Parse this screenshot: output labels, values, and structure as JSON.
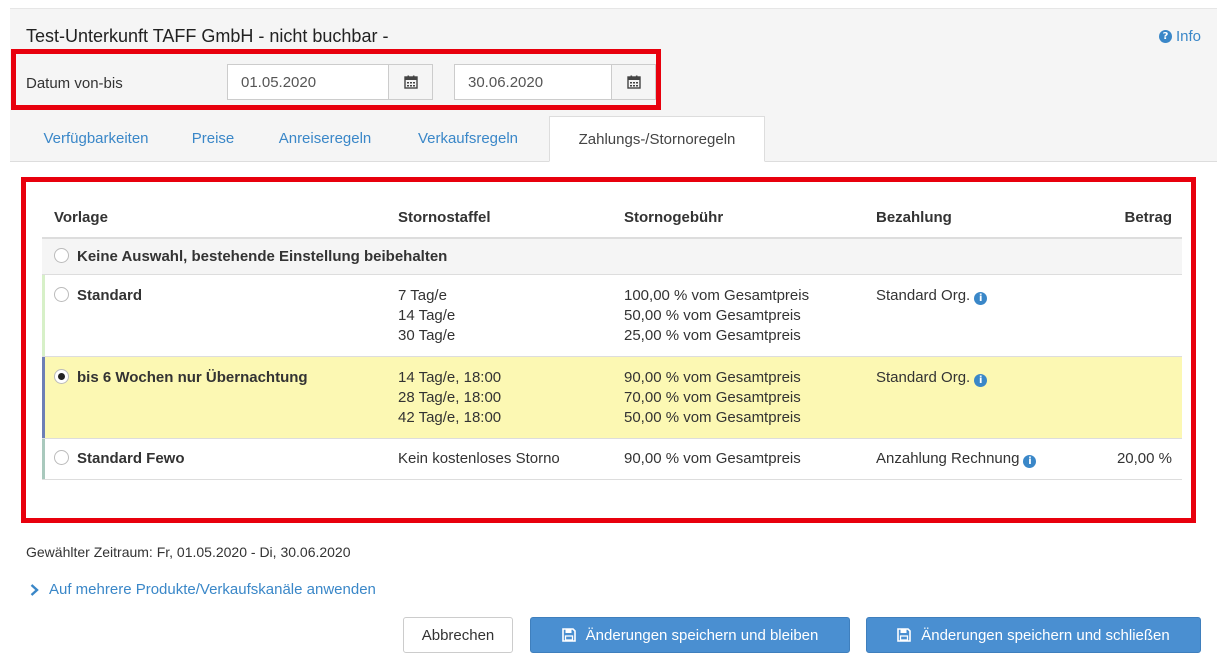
{
  "header": {
    "title": "Test-Unterkunft TAFF GmbH - nicht buchbar -",
    "info_label": "Info",
    "date_label": "Datum von-bis",
    "date_from": "01.05.2020",
    "date_to": "30.06.2020"
  },
  "tabs": [
    {
      "label": "Verfügbarkeiten"
    },
    {
      "label": "Preise"
    },
    {
      "label": "Anreiseregeln"
    },
    {
      "label": "Verkaufsregeln"
    },
    {
      "label": "Zahlungs-/Stornoregeln",
      "active": true
    }
  ],
  "table": {
    "columns": [
      "Vorlage",
      "Stornostaffel",
      "Stornogebühr",
      "Bezahlung",
      "Betrag"
    ],
    "none_option": "Keine Auswahl, bestehende Einstellung beibehalten",
    "rows": [
      {
        "name": "Standard",
        "staffel": [
          "7 Tag/e",
          "14 Tag/e",
          "30 Tag/e"
        ],
        "gebuehr": [
          "100,00 % vom Gesamtpreis",
          "50,00 % vom Gesamtpreis",
          "25,00 % vom Gesamtpreis"
        ],
        "bezahlung": "Standard Org.",
        "betrag": "",
        "accent": "#d7f0c8",
        "selected": false
      },
      {
        "name": "bis 6 Wochen nur Übernachtung",
        "staffel": [
          "14 Tag/e, 18:00",
          "28 Tag/e, 18:00",
          "42 Tag/e, 18:00"
        ],
        "gebuehr": [
          "90,00 % vom Gesamtpreis",
          "70,00 % vom Gesamtpreis",
          "50,00 % vom Gesamtpreis"
        ],
        "bezahlung": "Standard Org.",
        "betrag": "",
        "accent": "#6d7fb5",
        "selected": true
      },
      {
        "name": "Standard Fewo",
        "staffel": [
          "Kein kostenloses Storno"
        ],
        "gebuehr": [
          "90,00 % vom Gesamtpreis"
        ],
        "bezahlung": "Anzahlung Rechnung",
        "betrag": "20,00 %",
        "accent": "#a9c9bd",
        "selected": false
      }
    ]
  },
  "footer": {
    "summary": "Gewählter Zeitraum: Fr, 01.05.2020 - Di, 30.06.2020",
    "apply_link": "Auf mehrere Produkte/Verkaufskanäle anwenden",
    "cancel": "Abbrechen",
    "save_stay": "Änderungen speichern und bleiben",
    "save_close": "Änderungen speichern und schließen"
  },
  "colors": {
    "link": "#3a87c8",
    "highlight_box": "#e8000d",
    "selected_row": "#fcf8b3",
    "primary_button": "#4a8fd1"
  }
}
